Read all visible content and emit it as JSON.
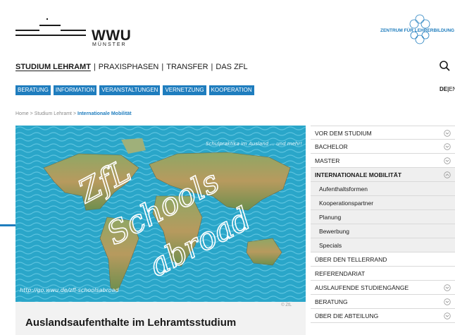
{
  "header": {
    "logo_text": "WWU",
    "logo_sub": "MÜNSTER",
    "zfl_text": "ZENTRUM FÜR LEHRERBILDUNG"
  },
  "main_nav": {
    "items": [
      "STUDIUM LEHRAMT",
      "PRAXISPHASEN",
      "TRANSFER",
      "DAS ZFL"
    ],
    "separator": "|"
  },
  "sub_nav": {
    "items": [
      "BERATUNG",
      "INFORMATION",
      "VERANSTALTUNGEN",
      "VERNETZUNG",
      "KOOPERATION"
    ]
  },
  "language": {
    "active": "DE",
    "separator": "|",
    "other": "EN"
  },
  "breadcrumb": {
    "items": [
      "Home",
      "Studium Lehramt"
    ],
    "current": "Internationale Mobilität",
    "separator": ">"
  },
  "hero": {
    "tagline": "Schulpraktika im Ausland ... und mehr!",
    "line1": "ZfL",
    "line2": "Schools",
    "line3": "abroad",
    "url": "http://go.wwu.de/zfl-schoolsabroad",
    "credit": "© ZfL"
  },
  "page_title": "Auslandsaufenthalte im Lehramtsstudium",
  "sidebar": {
    "items": [
      {
        "label": "VOR DEM STUDIUM",
        "type": "main",
        "chevron": "down"
      },
      {
        "label": "BACHELOR",
        "type": "main",
        "chevron": "down"
      },
      {
        "label": "MASTER",
        "type": "main",
        "chevron": "down"
      },
      {
        "label": "INTERNATIONALE MOBILITÄT",
        "type": "active",
        "chevron": "up"
      },
      {
        "label": "Aufenthaltsformen",
        "type": "sub",
        "chevron": ""
      },
      {
        "label": "Kooperationspartner",
        "type": "sub",
        "chevron": ""
      },
      {
        "label": "Planung",
        "type": "sub",
        "chevron": ""
      },
      {
        "label": "Bewerbung",
        "type": "sub",
        "chevron": ""
      },
      {
        "label": "Specials",
        "type": "sub",
        "chevron": ""
      },
      {
        "label": "ÜBER DEN TELLERRAND",
        "type": "main",
        "chevron": ""
      },
      {
        "label": "REFERENDARIAT",
        "type": "main",
        "chevron": ""
      },
      {
        "label": "AUSLAUFENDE STUDIENGÄNGE",
        "type": "main",
        "chevron": "down"
      },
      {
        "label": "BERATUNG",
        "type": "main",
        "chevron": "down"
      },
      {
        "label": "ÜBER DIE ABTEILUNG",
        "type": "main",
        "chevron": "down"
      }
    ]
  },
  "colors": {
    "accent": "#1f7dbe",
    "ocean": "#2aa6c9",
    "text": "#1a1a1a"
  }
}
